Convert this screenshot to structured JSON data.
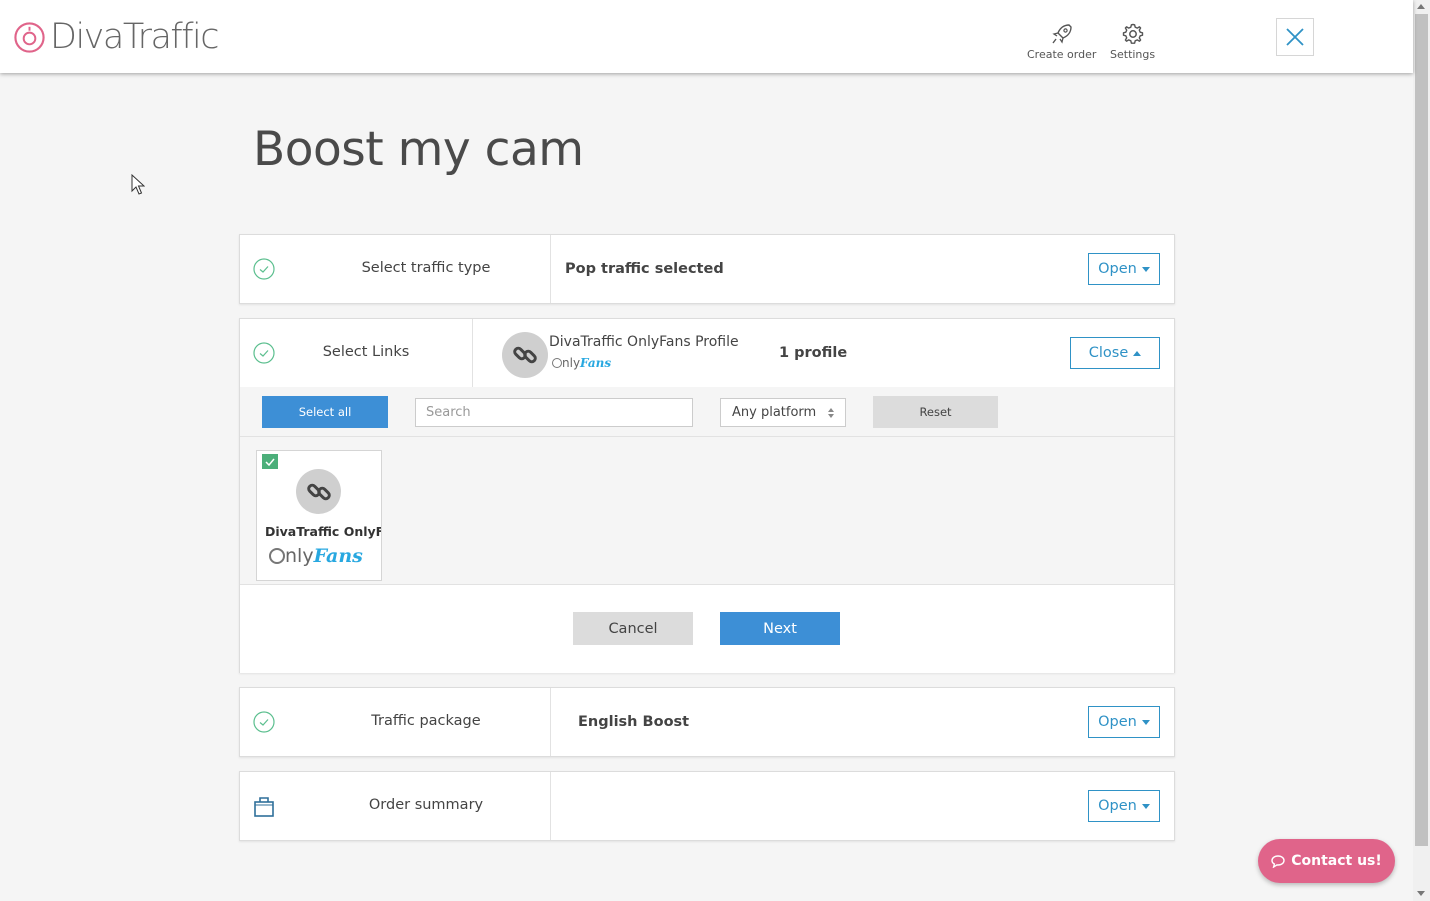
{
  "header": {
    "logo_text": "DivaTraffic",
    "create_order_label": "Create order",
    "settings_label": "Settings"
  },
  "page": {
    "title": "Boost my cam"
  },
  "steps": {
    "traffic_type": {
      "label": "Select traffic type",
      "value": "Pop traffic selected",
      "button": "Open"
    },
    "links": {
      "label": "Select Links",
      "profile_name": "DivaTraffic OnlyFans Profile",
      "platform_only": "nly",
      "platform_fans": "Fans",
      "count": "1 profile",
      "button": "Close",
      "filters": {
        "select_all": "Select all",
        "search_placeholder": "Search",
        "platform_select": "Any platform",
        "reset": "Reset"
      },
      "cards": [
        {
          "name": "DivaTraffic OnlyFans Profile",
          "checked": true,
          "platform_only": "nly",
          "platform_fans": "Fans"
        }
      ],
      "cancel": "Cancel",
      "next": "Next"
    },
    "package": {
      "label": "Traffic package",
      "value": "English Boost",
      "button": "Open"
    },
    "summary": {
      "label": "Order summary",
      "value": "",
      "button": "Open"
    }
  },
  "contact": {
    "label": "Contact us!"
  },
  "colors": {
    "accent_blue": "#2f92c6",
    "button_blue": "#3d8fd6",
    "brand_pink": "#e0648a",
    "check_green": "#4caf7a",
    "onlyfans_blue": "#28a8e0"
  },
  "icons": [
    "rocket-icon",
    "gear-icon",
    "close-icon",
    "check-circle-icon",
    "link-icon",
    "shopping-bag-icon",
    "chat-bubble-icon"
  ]
}
